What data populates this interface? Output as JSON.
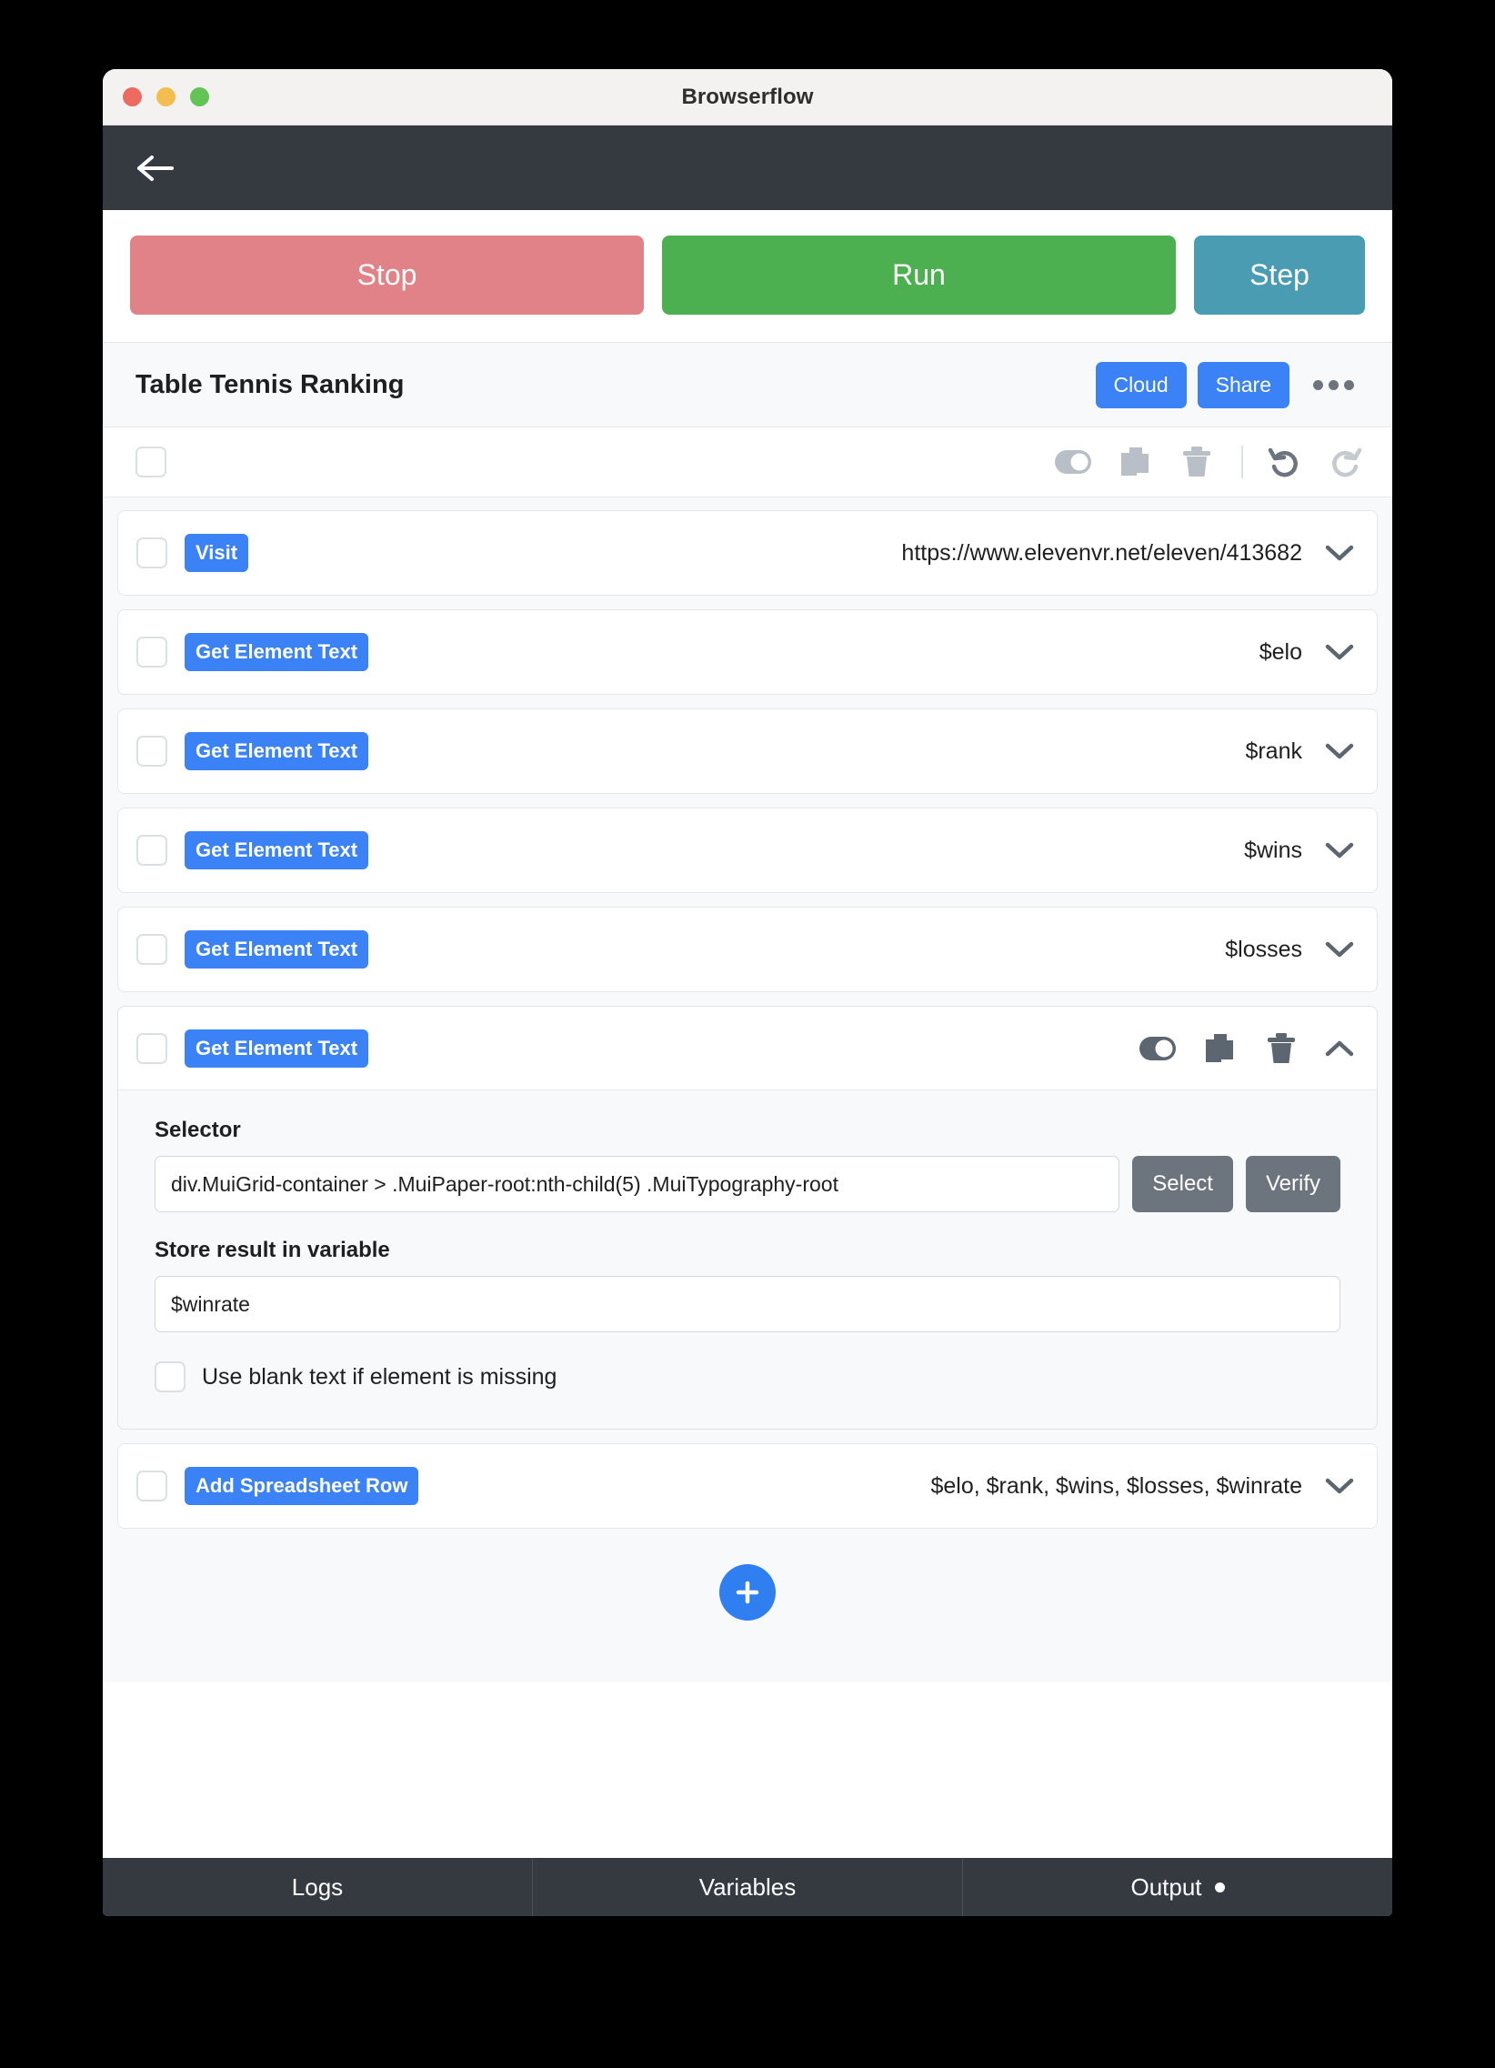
{
  "window": {
    "title": "Browserflow",
    "traffic_lights": [
      "close-red",
      "minimize-yellow",
      "maximize-green"
    ]
  },
  "navbar": {
    "back_icon": "arrow-left-icon"
  },
  "run_controls": {
    "stop_label": "Stop",
    "run_label": "Run",
    "step_label": "Step",
    "stop_color": "#e08287",
    "run_color": "#4caf50",
    "step_color": "#4a9cb3"
  },
  "flow_header": {
    "title": "Table Tennis Ranking",
    "cloud_label": "Cloud",
    "share_label": "Share",
    "more_icon": "more-horizontal-icon",
    "accent_color": "#3b82f6"
  },
  "select_toolbar": {
    "toggle_icon": "toggle-switch-icon",
    "duplicate_icon": "copy-icon",
    "delete_icon": "trash-icon",
    "undo_icon": "undo-icon",
    "redo_icon": "redo-icon"
  },
  "steps": [
    {
      "type": "Visit",
      "summary": "https://www.elevenvr.net/eleven/413682",
      "expanded": false
    },
    {
      "type": "Get Element Text",
      "summary": "$elo",
      "expanded": false
    },
    {
      "type": "Get Element Text",
      "summary": "$rank",
      "expanded": false
    },
    {
      "type": "Get Element Text",
      "summary": "$wins",
      "expanded": false
    },
    {
      "type": "Get Element Text",
      "summary": "$losses",
      "expanded": false
    },
    {
      "type": "Get Element Text",
      "summary": "",
      "expanded": true
    },
    {
      "type": "Add Spreadsheet Row",
      "summary": "$elo, $rank, $wins, $losses, $winrate",
      "expanded": false
    }
  ],
  "expanded_step": {
    "selector_label": "Selector",
    "selector_value": "div.MuiGrid-container > .MuiPaper-root:nth-child(5) .MuiTypography-root",
    "select_button": "Select",
    "verify_button": "Verify",
    "variable_label": "Store result in variable",
    "variable_value": "$winrate",
    "blank_text_label": "Use blank text if element is missing",
    "blank_text_checked": false
  },
  "add_step": {
    "icon": "plus-icon"
  },
  "tabs": [
    {
      "label": "Logs",
      "has_dot": false
    },
    {
      "label": "Variables",
      "has_dot": false
    },
    {
      "label": "Output",
      "has_dot": true
    }
  ]
}
